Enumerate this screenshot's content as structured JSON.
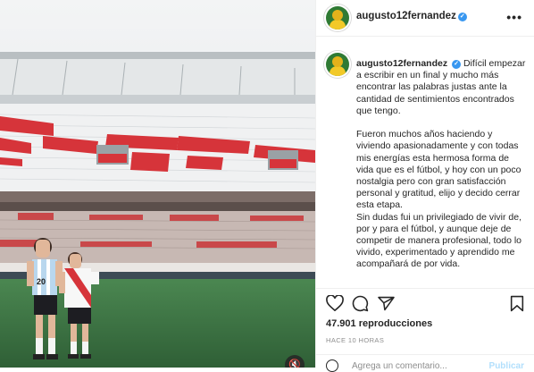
{
  "post": {
    "username": "augusto12fernandez",
    "verified_mark": "✓",
    "more_icon": "•••",
    "caption_username": "augusto12fernandez",
    "caption_text": "Difícil empezar a escribir en un final y mucho más encontrar las palabras justas ante la cantidad de sentimientos encontrados que tengo.\n\nFueron muchos años haciendo y viviendo apasionadamente y con todas mis energías esta hermosa forma de vida que es el fútbol, y hoy con un poco nostalgia pero con gran satisfacción personal y gratitud, elijo y decido cerrar esta etapa.\nSin dudas fui un privilegiado de vivir de, por y para el fútbol, y aunque deje de competir de manera profesional, todo lo vivido, experimentado y aprendido me acompañará de por vida.",
    "views": "47.901 reproducciones",
    "time_ago": "HACE 10 HORAS",
    "comment_placeholder": "Agrega un comentario...",
    "publish_label": "Publicar"
  },
  "media": {
    "sound_icon": "🔇",
    "jersey_number": "20"
  },
  "icons": [
    "heart-icon",
    "comment-icon",
    "share-icon",
    "save-icon",
    "more-icon",
    "emoji-icon",
    "mute-icon"
  ],
  "colors": {
    "stadium_red": "#d6343a",
    "pitch_green": "#3f7a45",
    "verified_blue": "#3897f0",
    "meta_gray": "#8e8e8e"
  }
}
